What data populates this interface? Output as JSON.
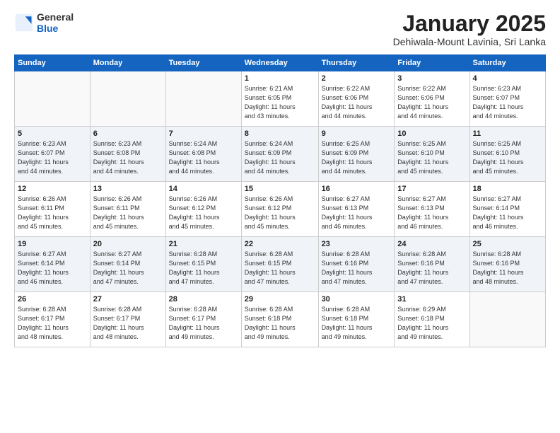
{
  "header": {
    "logo_general": "General",
    "logo_blue": "Blue",
    "month_title": "January 2025",
    "subtitle": "Dehiwala-Mount Lavinia, Sri Lanka"
  },
  "weekdays": [
    "Sunday",
    "Monday",
    "Tuesday",
    "Wednesday",
    "Thursday",
    "Friday",
    "Saturday"
  ],
  "weeks": [
    [
      {
        "day": "",
        "info": ""
      },
      {
        "day": "",
        "info": ""
      },
      {
        "day": "",
        "info": ""
      },
      {
        "day": "1",
        "info": "Sunrise: 6:21 AM\nSunset: 6:05 PM\nDaylight: 11 hours\nand 43 minutes."
      },
      {
        "day": "2",
        "info": "Sunrise: 6:22 AM\nSunset: 6:06 PM\nDaylight: 11 hours\nand 44 minutes."
      },
      {
        "day": "3",
        "info": "Sunrise: 6:22 AM\nSunset: 6:06 PM\nDaylight: 11 hours\nand 44 minutes."
      },
      {
        "day": "4",
        "info": "Sunrise: 6:23 AM\nSunset: 6:07 PM\nDaylight: 11 hours\nand 44 minutes."
      }
    ],
    [
      {
        "day": "5",
        "info": "Sunrise: 6:23 AM\nSunset: 6:07 PM\nDaylight: 11 hours\nand 44 minutes."
      },
      {
        "day": "6",
        "info": "Sunrise: 6:23 AM\nSunset: 6:08 PM\nDaylight: 11 hours\nand 44 minutes."
      },
      {
        "day": "7",
        "info": "Sunrise: 6:24 AM\nSunset: 6:08 PM\nDaylight: 11 hours\nand 44 minutes."
      },
      {
        "day": "8",
        "info": "Sunrise: 6:24 AM\nSunset: 6:09 PM\nDaylight: 11 hours\nand 44 minutes."
      },
      {
        "day": "9",
        "info": "Sunrise: 6:25 AM\nSunset: 6:09 PM\nDaylight: 11 hours\nand 44 minutes."
      },
      {
        "day": "10",
        "info": "Sunrise: 6:25 AM\nSunset: 6:10 PM\nDaylight: 11 hours\nand 45 minutes."
      },
      {
        "day": "11",
        "info": "Sunrise: 6:25 AM\nSunset: 6:10 PM\nDaylight: 11 hours\nand 45 minutes."
      }
    ],
    [
      {
        "day": "12",
        "info": "Sunrise: 6:26 AM\nSunset: 6:11 PM\nDaylight: 11 hours\nand 45 minutes."
      },
      {
        "day": "13",
        "info": "Sunrise: 6:26 AM\nSunset: 6:11 PM\nDaylight: 11 hours\nand 45 minutes."
      },
      {
        "day": "14",
        "info": "Sunrise: 6:26 AM\nSunset: 6:12 PM\nDaylight: 11 hours\nand 45 minutes."
      },
      {
        "day": "15",
        "info": "Sunrise: 6:26 AM\nSunset: 6:12 PM\nDaylight: 11 hours\nand 45 minutes."
      },
      {
        "day": "16",
        "info": "Sunrise: 6:27 AM\nSunset: 6:13 PM\nDaylight: 11 hours\nand 46 minutes."
      },
      {
        "day": "17",
        "info": "Sunrise: 6:27 AM\nSunset: 6:13 PM\nDaylight: 11 hours\nand 46 minutes."
      },
      {
        "day": "18",
        "info": "Sunrise: 6:27 AM\nSunset: 6:14 PM\nDaylight: 11 hours\nand 46 minutes."
      }
    ],
    [
      {
        "day": "19",
        "info": "Sunrise: 6:27 AM\nSunset: 6:14 PM\nDaylight: 11 hours\nand 46 minutes."
      },
      {
        "day": "20",
        "info": "Sunrise: 6:27 AM\nSunset: 6:14 PM\nDaylight: 11 hours\nand 47 minutes."
      },
      {
        "day": "21",
        "info": "Sunrise: 6:28 AM\nSunset: 6:15 PM\nDaylight: 11 hours\nand 47 minutes."
      },
      {
        "day": "22",
        "info": "Sunrise: 6:28 AM\nSunset: 6:15 PM\nDaylight: 11 hours\nand 47 minutes."
      },
      {
        "day": "23",
        "info": "Sunrise: 6:28 AM\nSunset: 6:16 PM\nDaylight: 11 hours\nand 47 minutes."
      },
      {
        "day": "24",
        "info": "Sunrise: 6:28 AM\nSunset: 6:16 PM\nDaylight: 11 hours\nand 47 minutes."
      },
      {
        "day": "25",
        "info": "Sunrise: 6:28 AM\nSunset: 6:16 PM\nDaylight: 11 hours\nand 48 minutes."
      }
    ],
    [
      {
        "day": "26",
        "info": "Sunrise: 6:28 AM\nSunset: 6:17 PM\nDaylight: 11 hours\nand 48 minutes."
      },
      {
        "day": "27",
        "info": "Sunrise: 6:28 AM\nSunset: 6:17 PM\nDaylight: 11 hours\nand 48 minutes."
      },
      {
        "day": "28",
        "info": "Sunrise: 6:28 AM\nSunset: 6:17 PM\nDaylight: 11 hours\nand 49 minutes."
      },
      {
        "day": "29",
        "info": "Sunrise: 6:28 AM\nSunset: 6:18 PM\nDaylight: 11 hours\nand 49 minutes."
      },
      {
        "day": "30",
        "info": "Sunrise: 6:28 AM\nSunset: 6:18 PM\nDaylight: 11 hours\nand 49 minutes."
      },
      {
        "day": "31",
        "info": "Sunrise: 6:29 AM\nSunset: 6:18 PM\nDaylight: 11 hours\nand 49 minutes."
      },
      {
        "day": "",
        "info": ""
      }
    ]
  ]
}
